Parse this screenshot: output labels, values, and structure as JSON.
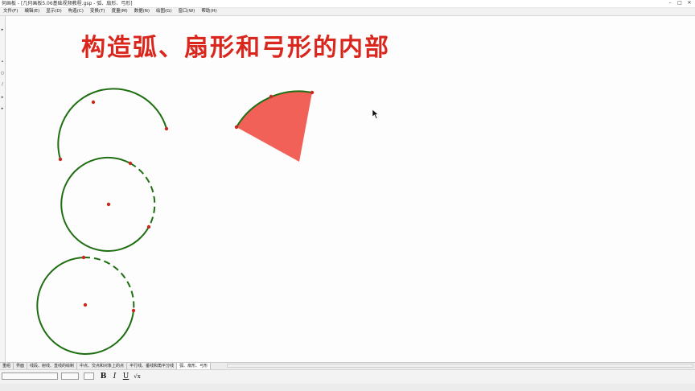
{
  "window": {
    "title": "何画板 - [几何画板5.06基础视频教程.gsp - 弧、扇形、弓形]",
    "minimize": "–",
    "maximize": "□",
    "close": "✕"
  },
  "menu": [
    "文件(F)",
    "编辑(E)",
    "显示(D)",
    "构造(C)",
    "变换(T)",
    "度量(M)",
    "数据(N)",
    "绘图(G)",
    "窗口(W)",
    "帮助(H)"
  ],
  "canvas": {
    "heading": "构造弧、扇形和弓形的内部"
  },
  "colors": {
    "heading": "#d9271e",
    "arc": "#1f6e12",
    "point": "#c62a1f",
    "sector_fill": "#f26157"
  },
  "tabs": [
    "重组",
    "界面",
    "线段、射线、直线的绘制",
    "中点、交点和对象上的点",
    "平行线、垂线和角平分线",
    "弧、扇形、弓形"
  ],
  "active_tab": 5,
  "format": {
    "bold": "B",
    "italic": "I",
    "underline": "U"
  },
  "icons": [
    "arrow-tool-icon",
    "point-tool-icon",
    "compass-tool-icon",
    "line-tool-icon",
    "polygon-tool-icon",
    "text-tool-icon",
    "mouse-cursor-icon"
  ]
}
